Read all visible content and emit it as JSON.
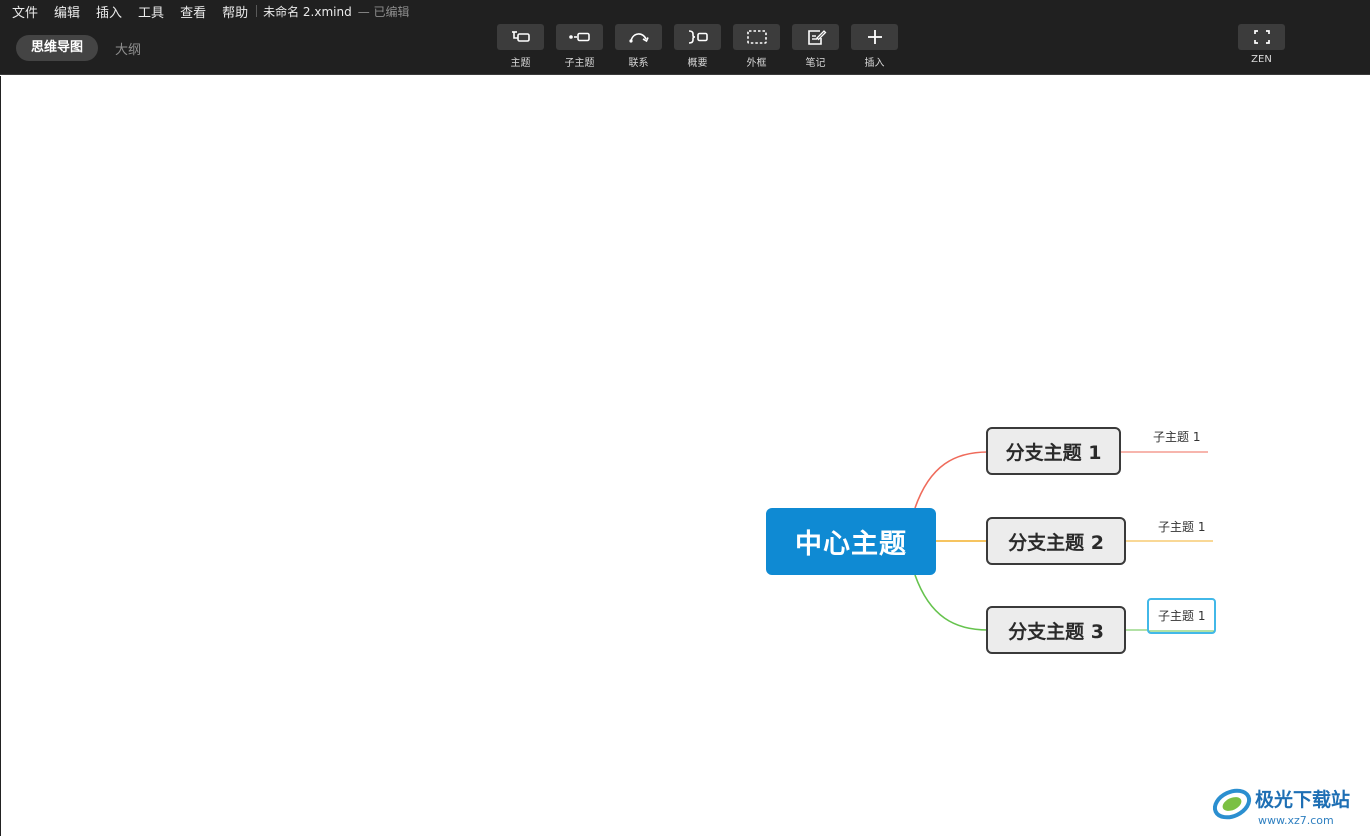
{
  "menu": {
    "file": "文件",
    "edit": "编辑",
    "insert": "插入",
    "tools": "工具",
    "view": "查看",
    "help": "帮助"
  },
  "document": {
    "title": "未命名 2.xmind",
    "status": "— 已编辑"
  },
  "view_tabs": {
    "mindmap": "思维导图",
    "outline": "大纲"
  },
  "toolbar": {
    "topic": "主题",
    "subtopic": "子主题",
    "relationship": "联系",
    "summary": "概要",
    "boundary": "外框",
    "notes": "笔记",
    "insert": "插入",
    "zen": "ZEN"
  },
  "mindmap": {
    "central": "中心主题",
    "branches": [
      {
        "label": "分支主题 1",
        "color": "#ef6b5b",
        "child": "子主题 1"
      },
      {
        "label": "分支主题 2",
        "color": "#f3b12c",
        "child": "子主题 1"
      },
      {
        "label": "分支主题 3",
        "color": "#66c34e",
        "child": "子主题 1"
      }
    ],
    "central_color": "#0f8ad3",
    "selection_color": "#42b8e8"
  },
  "watermark": {
    "name": "极光下载站",
    "url": "www.xz7.com"
  }
}
